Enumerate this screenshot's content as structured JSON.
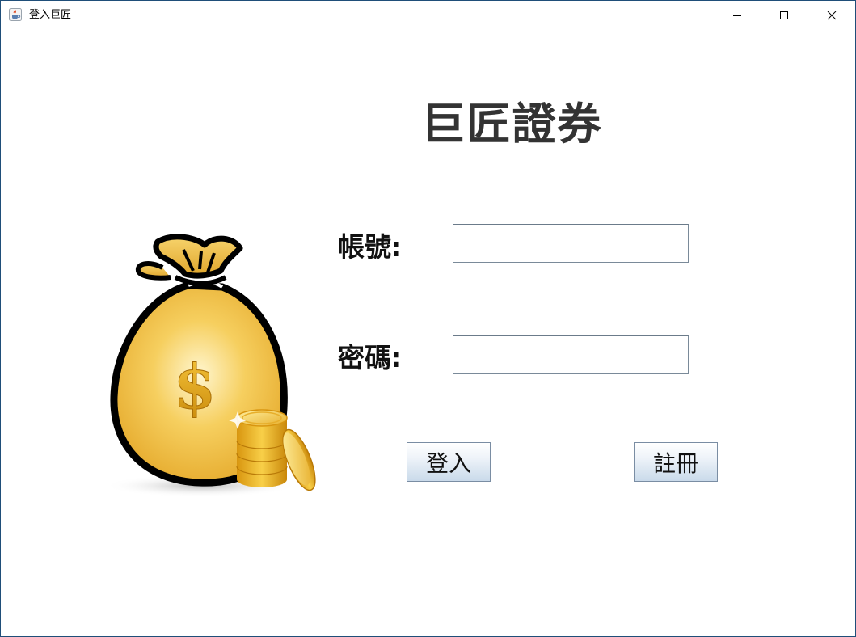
{
  "window": {
    "title": "登入巨匠",
    "icon": "java-cup-icon"
  },
  "titlebar_controls": [
    "minimize-icon",
    "maximize-icon",
    "close-icon"
  ],
  "heading": "巨匠證券",
  "form": {
    "account_label": "帳號:",
    "account_value": "",
    "password_label": "密碼:",
    "password_value": ""
  },
  "buttons": {
    "login": "登入",
    "register": "註冊"
  },
  "illustration": {
    "name": "money-bag-with-coins",
    "symbol": "$"
  },
  "colors": {
    "gold": "#f2c04a",
    "gold_dark": "#d99a12",
    "outline": "#000000",
    "button_gradient_bottom": "#c9daea"
  }
}
